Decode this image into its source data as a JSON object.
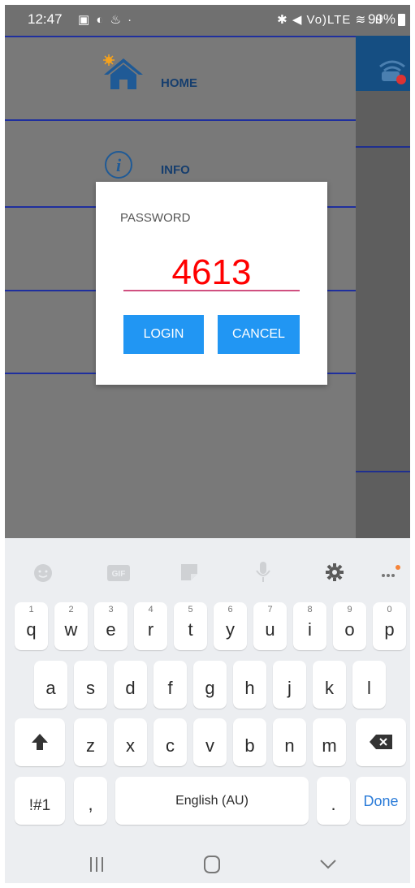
{
  "status_bar": {
    "time": "12:47",
    "notifications": "▣ ◐ ♨ ·",
    "indicators": "✱ ◀ Vo)LTE ≋ .ıl",
    "battery": "99%"
  },
  "drawer": {
    "items": [
      {
        "label": "HOME",
        "icon": "home-icon"
      },
      {
        "label": "INFO",
        "icon": "info-icon"
      }
    ]
  },
  "dialog": {
    "label": "PASSWORD",
    "value": "4613",
    "login": "LOGIN",
    "cancel": "CANCEL"
  },
  "keyboard": {
    "toolbar": [
      "emoji-icon",
      "gif-icon",
      "sticker-icon",
      "mic-icon",
      "settings-icon",
      "more-icon"
    ],
    "row1": [
      {
        "k": "q",
        "h": "1"
      },
      {
        "k": "w",
        "h": "2"
      },
      {
        "k": "e",
        "h": "3"
      },
      {
        "k": "r",
        "h": "4"
      },
      {
        "k": "t",
        "h": "5"
      },
      {
        "k": "y",
        "h": "6"
      },
      {
        "k": "u",
        "h": "7"
      },
      {
        "k": "i",
        "h": "8"
      },
      {
        "k": "o",
        "h": "9"
      },
      {
        "k": "p",
        "h": "0"
      }
    ],
    "row2": [
      "a",
      "s",
      "d",
      "f",
      "g",
      "h",
      "j",
      "k",
      "l"
    ],
    "row3": [
      "z",
      "x",
      "c",
      "v",
      "b",
      "n",
      "m"
    ],
    "symbols": "!#1",
    "comma": ",",
    "space": "English (AU)",
    "period": ".",
    "done": "Done"
  }
}
